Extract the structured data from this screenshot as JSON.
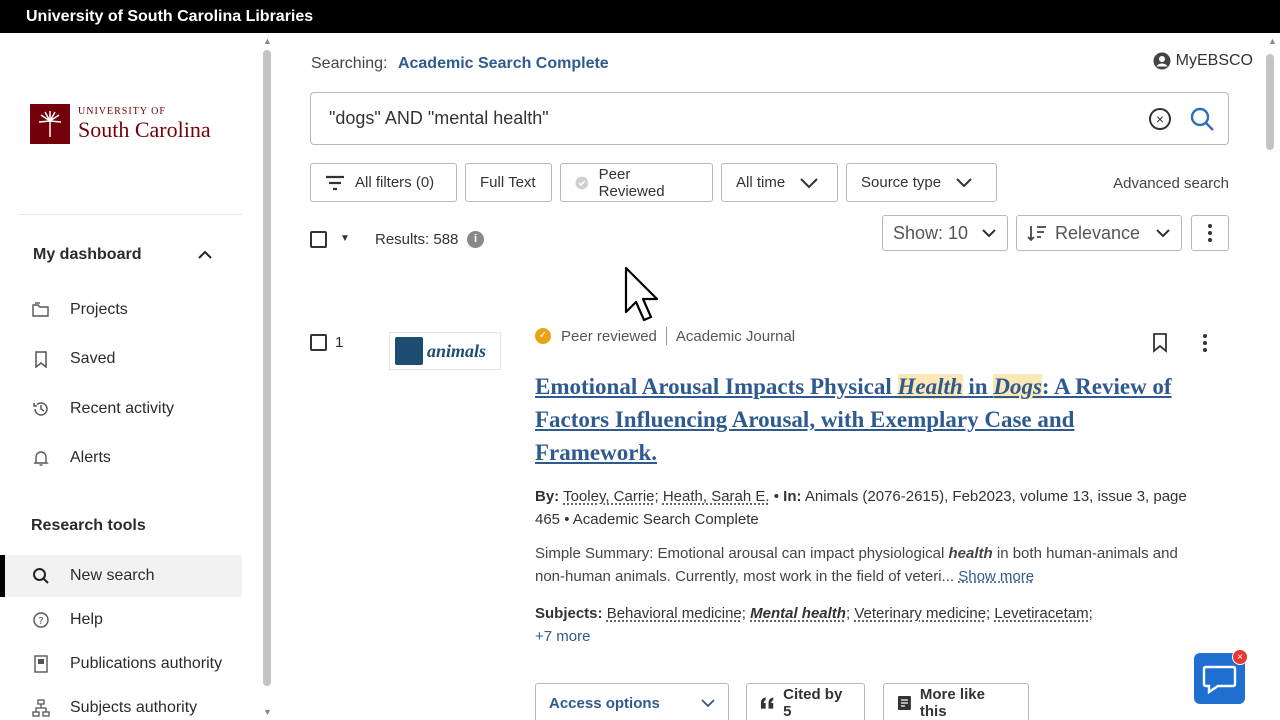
{
  "banner": {
    "title": "University of South Carolina Libraries"
  },
  "logo": {
    "line1": "UNIVERSITY OF",
    "line2": "South Carolina"
  },
  "sidebar": {
    "dashboard_label": "My dashboard",
    "dashboard_items": [
      {
        "label": "Projects",
        "icon": "folders-icon"
      },
      {
        "label": "Saved",
        "icon": "bookmark-icon"
      },
      {
        "label": "Recent activity",
        "icon": "history-icon"
      },
      {
        "label": "Alerts",
        "icon": "bell-icon"
      }
    ],
    "research_label": "Research tools",
    "research_items": [
      {
        "label": "New search",
        "icon": "search-icon",
        "active": true
      },
      {
        "label": "Help",
        "icon": "help-icon"
      },
      {
        "label": "Publications authority",
        "icon": "publication-icon"
      },
      {
        "label": "Subjects authority",
        "icon": "hierarchy-icon"
      }
    ]
  },
  "header": {
    "searching_label": "Searching:",
    "database": "Academic Search Complete",
    "account": "MyEBSCO"
  },
  "search": {
    "query": "\"dogs\" AND \"mental health\""
  },
  "filters": {
    "all_filters": "All filters (0)",
    "full_text": "Full Text",
    "peer_reviewed": "Peer Reviewed",
    "all_time": "All time",
    "source_type": "Source type",
    "advanced": "Advanced search"
  },
  "results_bar": {
    "count": "Results: 588",
    "info": "i",
    "show": "Show: 10",
    "sort": "Relevance"
  },
  "result": {
    "number": "1",
    "journal_logo": "animals",
    "peer": "Peer reviewed",
    "type": "Academic Journal",
    "title_parts": {
      "a": "Emotional Arousal Impacts Physical ",
      "b": "Health",
      "c": " in ",
      "d": "Dogs",
      "e": ": A Review of Factors Influencing Arousal, with Exemplary Case and Framework."
    },
    "by_label": "By:",
    "author1": "Tooley, Carrie",
    "author2": "Heath, Sarah E.",
    "in_label": "In:",
    "source": "Animals (2076-2615), Feb2023, volume 13, issue 3, page 465 • Academic Search Complete",
    "summary_a": "Simple Summary: Emotional arousal can impact physiological ",
    "summary_b": "health",
    "summary_c": " in both human-animals and non-human animals. Currently, most work in the field of veteri...",
    "show_more": "Show more",
    "subjects_label": "Subjects:",
    "subjects": [
      "Behavioral medicine",
      "Mental health",
      "Veterinary medicine",
      "Levetiracetam"
    ],
    "more_subjects": "+7 more",
    "access": "Access options",
    "cited": "Cited by 5",
    "more_like": "More like this"
  }
}
